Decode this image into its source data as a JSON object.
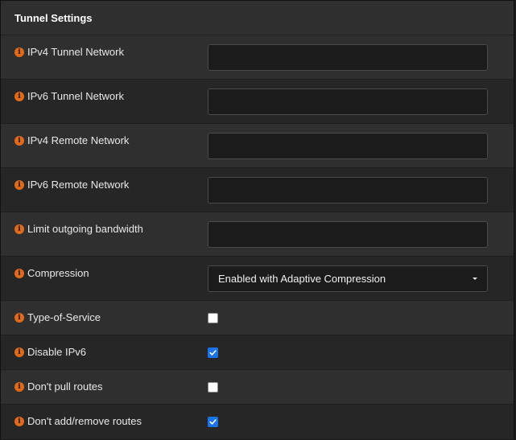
{
  "panel": {
    "title": "Tunnel Settings"
  },
  "fields": [
    {
      "label": "IPv4 Tunnel Network",
      "type": "text",
      "value": ""
    },
    {
      "label": "IPv6 Tunnel Network",
      "type": "text",
      "value": ""
    },
    {
      "label": "IPv4 Remote Network",
      "type": "text",
      "value": ""
    },
    {
      "label": "IPv6 Remote Network",
      "type": "text",
      "value": ""
    },
    {
      "label": "Limit outgoing bandwidth",
      "type": "text",
      "value": ""
    },
    {
      "label": "Compression",
      "type": "select",
      "value": "Enabled with Adaptive Compression"
    },
    {
      "label": "Type-of-Service",
      "type": "checkbox",
      "checked": false
    },
    {
      "label": "Disable IPv6",
      "type": "checkbox",
      "checked": true
    },
    {
      "label": "Don't pull routes",
      "type": "checkbox",
      "checked": false
    },
    {
      "label": "Don't add/remove routes",
      "type": "checkbox",
      "checked": true
    }
  ],
  "icons": {
    "info": "info-circle-icon",
    "caret": "caret-down-icon",
    "check": "checkmark-icon"
  },
  "colors": {
    "info_icon": "#e06a1a",
    "checkbox_checked": "#1a73e8",
    "panel_bg": "#2b2b2b"
  }
}
